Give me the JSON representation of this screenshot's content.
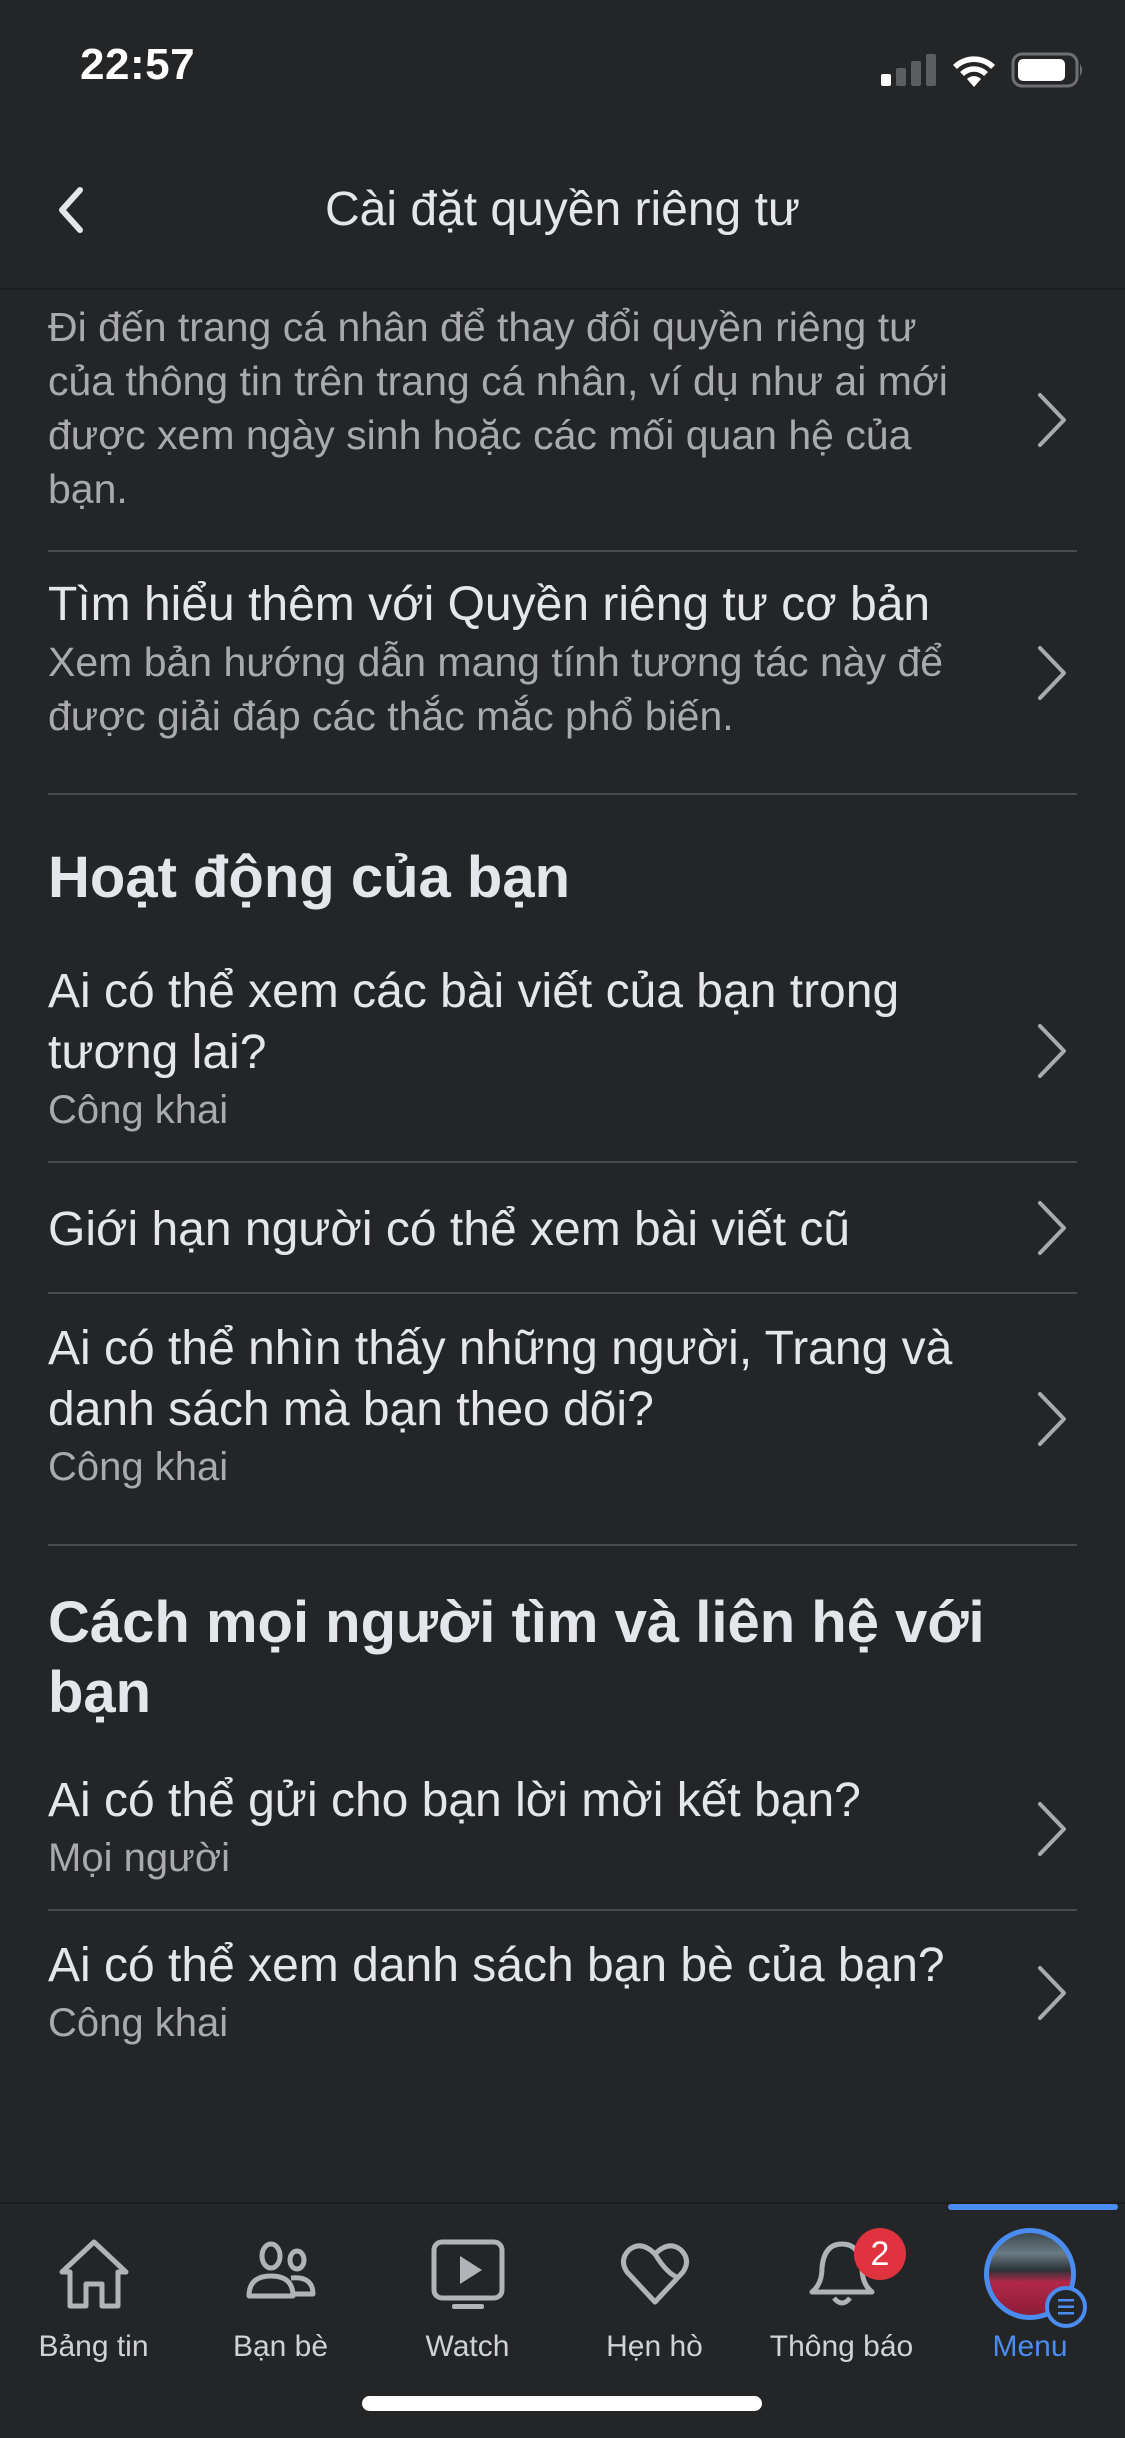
{
  "status_bar": {
    "time": "22:57",
    "signal_bars": 1,
    "signal_bars_total": 4,
    "battery_percent": 80
  },
  "header": {
    "title": "Cài đặt quyền riêng tư",
    "back_icon": "chevron-left-icon"
  },
  "rows_top": [
    {
      "title": "",
      "description": "Đi đến trang cá nhân để thay đổi quyền riêng tư của thông tin trên trang cá nhân, ví dụ như ai mới được xem ngày sinh hoặc các mối quan hệ của bạn."
    },
    {
      "title": "Tìm hiểu thêm với Quyền riêng tư cơ bản",
      "description": "Xem bản hướng dẫn mang tính tương tác này để được giải đáp các thắc mắc phổ biến."
    }
  ],
  "sections": [
    {
      "title": "Hoạt động của bạn",
      "items": [
        {
          "title": "Ai có thể xem các bài viết của bạn trong tương lai?",
          "value": "Công khai"
        },
        {
          "title": "Giới hạn người có thể xem bài viết cũ",
          "value": ""
        },
        {
          "title": "Ai có thể nhìn thấy những người, Trang và danh sách mà bạn theo dõi?",
          "value": "Công khai"
        }
      ]
    },
    {
      "title": "Cách mọi người tìm và liên hệ với bạn",
      "items": [
        {
          "title": "Ai có thể gửi cho bạn lời mời kết bạn?",
          "value": "Mọi người"
        },
        {
          "title": "Ai có thể xem danh sách bạn bè của bạn?",
          "value": "Công khai"
        }
      ]
    }
  ],
  "tabbar": {
    "tabs": [
      {
        "label": "Bảng tin",
        "icon": "home-icon"
      },
      {
        "label": "Bạn bè",
        "icon": "friends-icon"
      },
      {
        "label": "Watch",
        "icon": "watch-icon"
      },
      {
        "label": "Hẹn hò",
        "icon": "dating-heart-icon"
      },
      {
        "label": "Thông báo",
        "icon": "bell-icon",
        "badge": "2"
      },
      {
        "label": "Menu",
        "icon": "avatar-menu-icon",
        "active": true
      }
    ],
    "accent_color": "#4a8cf0",
    "badge_color": "#e0333f"
  }
}
